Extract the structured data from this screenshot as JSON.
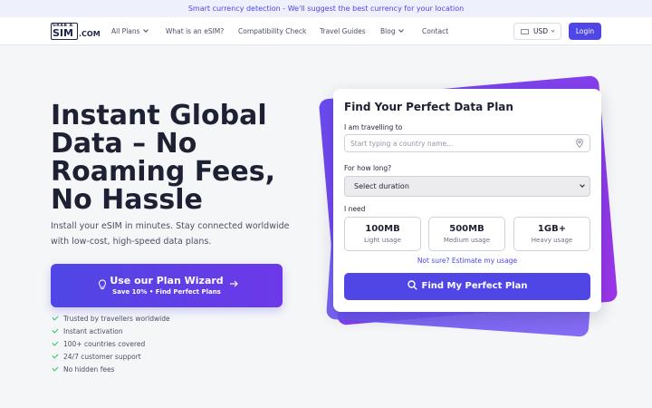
{
  "banner": {
    "text": "Smart currency detection - We'll suggest the best currency for your location"
  },
  "logo": {
    "top": "GRAB A",
    "main": "SIM",
    "suffix": ".COM"
  },
  "nav": {
    "items": [
      {
        "label": "All Plans",
        "dropdown": true
      },
      {
        "label": "What is an eSIM?"
      },
      {
        "label": "Compatibility Check"
      },
      {
        "label": "Travel Guides"
      },
      {
        "label": "Blog",
        "dropdown": true
      },
      {
        "label": "Contact"
      }
    ],
    "currency": "USD",
    "login": "Login"
  },
  "hero": {
    "title": "Instant Global Data – No Roaming Fees, No Hassle",
    "subtitle": "Install your eSIM in minutes. Stay connected worldwide with low-cost, high-speed data plans."
  },
  "wizard": {
    "title": "Use our Plan Wizard",
    "subtitle": "Save 10% • Find Perfect Plans",
    "icon": "lightbulb-icon"
  },
  "checks": [
    "Trusted by travellers worldwide",
    "Instant activation",
    "100+ countries covered",
    "24/7 customer support",
    "No hidden fees"
  ],
  "card": {
    "title": "Find Your Perfect Data Plan",
    "country_label": "I am travelling to",
    "country_placeholder": "Start typing a country name...",
    "duration_label": "For how long?",
    "duration_value": "Select duration",
    "need_label": "I need",
    "usage": [
      {
        "amount": "100MB",
        "desc": "Light usage"
      },
      {
        "amount": "500MB",
        "desc": "Medium usage"
      },
      {
        "amount": "1GB+",
        "desc": "Heavy usage"
      }
    ],
    "estimate_link": "Not sure? Estimate my usage",
    "find_button": "Find My Perfect Plan"
  },
  "colors": {
    "primary": "#4f46e5",
    "accent": "#8b3ce8",
    "check": "#22c55e"
  }
}
